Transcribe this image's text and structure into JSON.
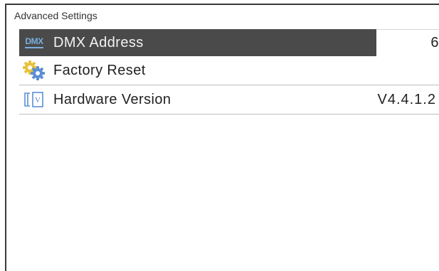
{
  "header": {
    "title": "Advanced Settings"
  },
  "menu": {
    "items": [
      {
        "label": "DMX Address",
        "value": "6",
        "icon": "dmx-icon",
        "icon_text": "DMX",
        "selected": true
      },
      {
        "label": "Factory Reset",
        "value": "",
        "icon": "gears-icon",
        "selected": false
      },
      {
        "label": "Hardware Version",
        "value": "V4.4.1.2",
        "icon": "hardware-version-icon",
        "icon_text": "V",
        "selected": false
      }
    ]
  },
  "colors": {
    "selected_background": "#4a4a4a",
    "icon_blue": "#5b8fd4",
    "gear_yellow": "#e8c23a",
    "divider": "#bdbdbd"
  }
}
